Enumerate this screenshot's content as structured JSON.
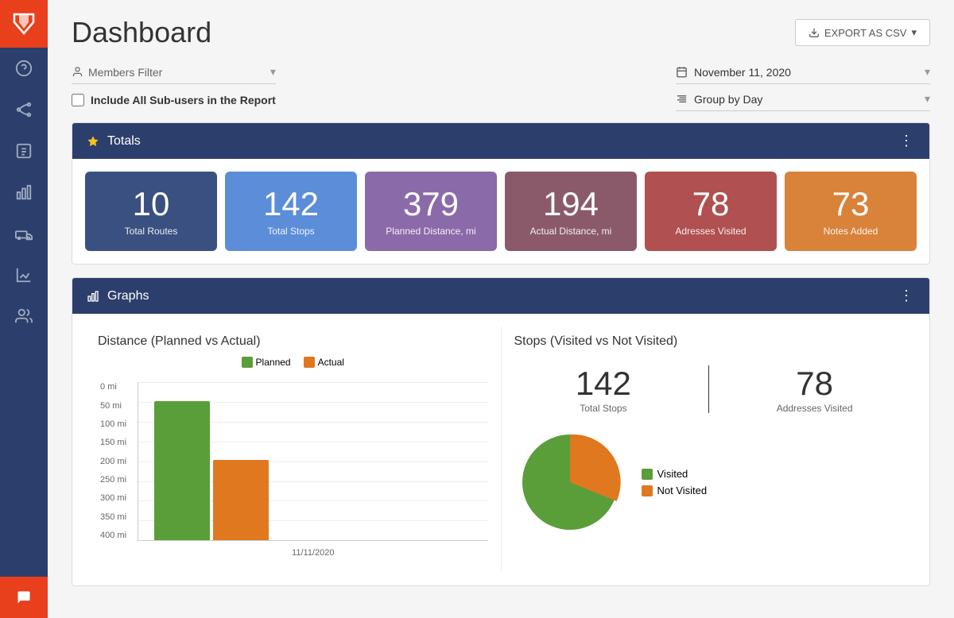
{
  "app": {
    "logo": "V"
  },
  "header": {
    "title": "Dashboard",
    "export_button": "EXPORT AS CSV"
  },
  "filters": {
    "members_placeholder": "Members Filter",
    "date_value": "November 11, 2020",
    "group_value": "Group by Day",
    "include_subusers_label": "Include All Sub-users in the Report"
  },
  "totals": {
    "section_title": "Totals",
    "cards": [
      {
        "value": "10",
        "label": "Total Routes",
        "color_class": "card-blue-dark"
      },
      {
        "value": "142",
        "label": "Total Stops",
        "color_class": "card-blue-med"
      },
      {
        "value": "379",
        "label": "Planned Distance, mi",
        "color_class": "card-purple"
      },
      {
        "value": "194",
        "label": "Actual Distance, mi",
        "color_class": "card-maroon"
      },
      {
        "value": "78",
        "label": "Adresses Visited",
        "color_class": "card-red-brown"
      },
      {
        "value": "73",
        "label": "Notes Added",
        "color_class": "card-orange"
      }
    ]
  },
  "graphs": {
    "section_title": "Graphs",
    "distance_chart": {
      "title": "Distance (Planned vs Actual)",
      "legend_planned": "Planned",
      "legend_actual": "Actual",
      "y_labels": [
        "0 mi",
        "50 mi",
        "100 mi",
        "150 mi",
        "200 mi",
        "250 mi",
        "300 mi",
        "350 mi",
        "400 mi"
      ],
      "x_label": "11/11/2020",
      "planned_height_pct": 88,
      "actual_height_pct": 51
    },
    "stops_chart": {
      "title": "Stops (Visited vs Not Visited)",
      "total_stops_value": "142",
      "total_stops_label": "Total Stops",
      "addresses_visited_value": "78",
      "addresses_visited_label": "Addresses Visited",
      "legend_visited": "Visited",
      "legend_not_visited": "Not Visited"
    }
  },
  "sidebar": {
    "icons": [
      "?",
      "👥",
      "🛒",
      "📊",
      "🚗",
      "📈",
      "👤"
    ]
  }
}
